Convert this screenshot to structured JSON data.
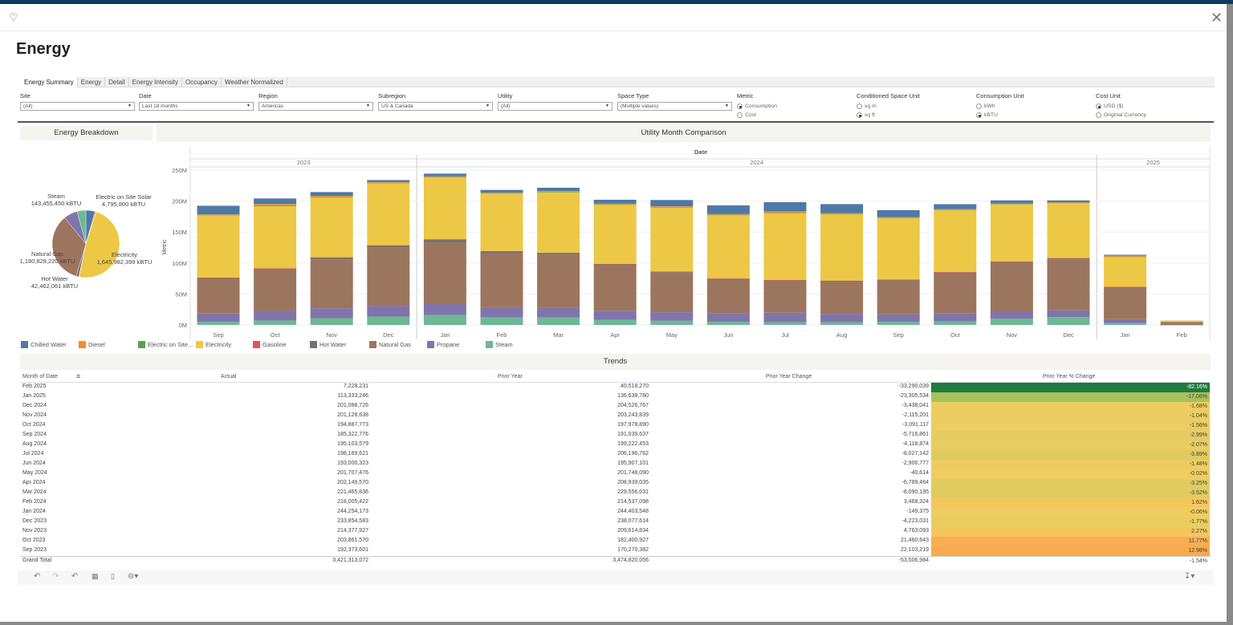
{
  "window": {
    "title": "Energy",
    "heart_icon": "heart-icon",
    "close_icon": "close-icon"
  },
  "tabs": [
    {
      "label": "Energy Summary",
      "active": true
    },
    {
      "label": "Energy"
    },
    {
      "label": "Detail"
    },
    {
      "label": "Energy Intensity"
    },
    {
      "label": "Occupancy"
    },
    {
      "label": "Weather Normalized"
    }
  ],
  "filters": [
    {
      "label": "Site",
      "type": "dropdown",
      "value": "(All)"
    },
    {
      "label": "Date",
      "type": "dropdown",
      "value": "Last 18 months"
    },
    {
      "label": "Region",
      "type": "dropdown",
      "value": "Americas"
    },
    {
      "label": "Subregion",
      "type": "dropdown",
      "value": "US & Canada"
    },
    {
      "label": "Utility",
      "type": "dropdown",
      "value": "(All)"
    },
    {
      "label": "Space Type",
      "type": "dropdown",
      "value": "(Multiple values)"
    },
    {
      "label": "Metric",
      "type": "radio",
      "options": [
        "Consumption",
        "Cost"
      ],
      "selected": 0
    },
    {
      "label": "Conditioned Space Unit",
      "type": "radio",
      "options": [
        "sq m",
        "sq ft"
      ],
      "selected": 1
    },
    {
      "label": "Consumption Unit",
      "type": "radio",
      "options": [
        "kWh",
        "kBTU"
      ],
      "selected": 1
    },
    {
      "label": "Cost Unit",
      "type": "radio",
      "options": [
        "USD ($)",
        "Original Currency"
      ],
      "selected": 0
    }
  ],
  "colors": {
    "Chilled Water": "#4e79a7",
    "Diesel": "#f28e2b",
    "Electric on Site Solar": "#59a14f",
    "Electricity": "#ecc846",
    "Gasoline": "#e15759",
    "Hot Water": "#76706e",
    "Natural Gas": "#9c755f",
    "Propane": "#8075ab",
    "Steam": "#6db895"
  },
  "energy_breakdown": {
    "title": "Energy Breakdown"
  },
  "utility_month": {
    "title": "Utility Month Comparison"
  },
  "legend": [
    "Chilled Water",
    "Diesel",
    "Electric on Site...",
    "Electricity",
    "Gasoline",
    "Hot Water",
    "Natural Gas",
    "Propane",
    "Steam"
  ],
  "chart_data": [
    {
      "type": "pie",
      "title": "Energy Breakdown",
      "unit": "kBTU",
      "slices": [
        {
          "name": "Chilled Water",
          "value": 150000000
        },
        {
          "name": "Diesel",
          "value": 20000000
        },
        {
          "name": "Electric on Site Solar",
          "value": 4795800,
          "label": "Electric on Site Solar",
          "value_text": "4,795,800 kBTU"
        },
        {
          "name": "Electricity",
          "value": 1645982399,
          "label": "Electricity",
          "value_text": "1,645,982,399 kBTU"
        },
        {
          "name": "Gasoline",
          "value": 8000000
        },
        {
          "name": "Hot Water",
          "value": 42462061,
          "label": "Hot Water",
          "value_text": "42,462,061 kBTU"
        },
        {
          "name": "Natural Gas",
          "value": 1180828220,
          "label": "Natural Gas",
          "value_text": "1,180,828,220 kBTU"
        },
        {
          "name": "Propane",
          "value": 227000000
        },
        {
          "name": "Steam",
          "value": 143455450,
          "label": "Steam",
          "value_text": "143,455,450 kBTU"
        }
      ]
    },
    {
      "type": "bar",
      "stacked": true,
      "title": "Utility Month Comparison",
      "xlabel": "Date",
      "ylabel": "Metric",
      "ylim": [
        0,
        250
      ],
      "yticks": [
        "0M",
        "50M",
        "100M",
        "150M",
        "200M",
        "250M"
      ],
      "grid": true,
      "legend": "bottom",
      "years": [
        {
          "label": "2023",
          "months": 4
        },
        {
          "label": "2024",
          "months": 12
        },
        {
          "label": "2025",
          "months": 2
        }
      ],
      "categories": [
        "Sep",
        "Oct",
        "Nov",
        "Dec",
        "Jan",
        "Feb",
        "Mar",
        "Apr",
        "May",
        "Jun",
        "Jul",
        "Aug",
        "Sep",
        "Oct",
        "Nov",
        "Dec",
        "Jan",
        "Feb"
      ],
      "series": [
        {
          "name": "Steam",
          "values": [
            5,
            7,
            11,
            13.5,
            16,
            12,
            12,
            8.4,
            6.7,
            5,
            4.2,
            4.2,
            5,
            5.9,
            10,
            12.6,
            3,
            0.2
          ]
        },
        {
          "name": "Propane",
          "values": [
            13.5,
            15.7,
            16,
            17.5,
            17.7,
            16.6,
            16,
            14.6,
            13.9,
            14,
            15.6,
            13.8,
            12,
            13.1,
            12,
            11,
            6.3,
            0.3
          ]
        },
        {
          "name": "Natural Gas",
          "values": [
            57.3,
            68.3,
            79,
            93.6,
            99.7,
            87.4,
            85,
            72,
            64.4,
            55,
            51.7,
            52.7,
            55.4,
            65.6,
            78,
            82.4,
            51.3,
            4
          ]
        },
        {
          "name": "Hot Water",
          "values": [
            0.5,
            0.3,
            3,
            3.8,
            4.6,
            3,
            3,
            3,
            1,
            0.5,
            0.5,
            0.5,
            0.5,
            0.5,
            2,
            1.7,
            0.5,
            0.1
          ]
        },
        {
          "name": "Gasoline",
          "values": [
            0.3,
            0.3,
            0.3,
            0.3,
            0.4,
            0.4,
            0.5,
            0.4,
            0.5,
            0.5,
            0.5,
            0.5,
            0.3,
            0.3,
            0.3,
            0.3,
            0.5,
            0
          ]
        },
        {
          "name": "Electricity",
          "values": [
            101,
            100.4,
            96.7,
            100.3,
            100.2,
            93.1,
            98.1,
            96,
            103.5,
            102.6,
            108,
            107.3,
            99.8,
            100.6,
            92.7,
            89,
            48.7,
            2.6
          ]
        },
        {
          "name": "Electric on Site Solar",
          "values": [
            0.3,
            0.3,
            0.5,
            0.5,
            0.5,
            0.5,
            0.5,
            0.5,
            0.5,
            0.4,
            0.4,
            0.5,
            0.5,
            0.4,
            0.5,
            0.5,
            0.3,
            0
          ]
        },
        {
          "name": "Diesel",
          "values": [
            0.5,
            3,
            2,
            1,
            1,
            0.8,
            1,
            1,
            1,
            1,
            2.5,
            1,
            0.5,
            0.5,
            0.6,
            0.6,
            1.5,
            0
          ]
        },
        {
          "name": "Chilled Water",
          "values": [
            14,
            8.9,
            6,
            3.4,
            4.2,
            4.2,
            5.4,
            6.2,
            10.2,
            14,
            14.8,
            14.6,
            11.3,
            8,
            5,
            3,
            1.2,
            0
          ]
        }
      ]
    }
  ],
  "trends": {
    "title": "Trends",
    "columns": [
      "Month of Date",
      "Actual",
      "Prior Year",
      "Prior Year Change",
      "Prior Year % Change"
    ],
    "sort_icon": "sort-icon",
    "rows": [
      {
        "month": "Feb 2025",
        "actual": "7,228,231",
        "prior": "40,518,270",
        "change": "-33,290,039",
        "pct": "-82.16%",
        "color": "#217a3e"
      },
      {
        "month": "Jan 2025",
        "actual": "113,333,246",
        "prior": "136,638,780",
        "change": "-23,305,534",
        "pct": "-17.06%",
        "color": "#a9c15b"
      },
      {
        "month": "Dec 2024",
        "actual": "201,088,726",
        "prior": "204,526,767",
        "change": "-3,438,041",
        "pct": "-1.68%",
        "color": "#eccd61"
      },
      {
        "month": "Nov 2024",
        "actual": "201,128,638",
        "prior": "203,243,839",
        "change": "-2,115,201",
        "pct": "-1.04%",
        "color": "#edcd61"
      },
      {
        "month": "Oct 2024",
        "actual": "194,887,773",
        "prior": "197,978,890",
        "change": "-3,091,117",
        "pct": "-1.56%",
        "color": "#eccd61"
      },
      {
        "month": "Sep 2024",
        "actual": "185,322,776",
        "prior": "191,039,637",
        "change": "-5,716,861",
        "pct": "-2.99%",
        "color": "#e4cc60"
      },
      {
        "month": "Aug 2024",
        "actual": "195,103,579",
        "prior": "199,222,453",
        "change": "-4,118,874",
        "pct": "-2.07%",
        "color": "#e9cd61"
      },
      {
        "month": "Jul 2024",
        "actual": "198,169,621",
        "prior": "206,196,762",
        "change": "-8,027,142",
        "pct": "-3.89%",
        "color": "#e0cb5f"
      },
      {
        "month": "Jun 2024",
        "actual": "193,000,323",
        "prior": "195,907,101",
        "change": "-2,906,777",
        "pct": "-1.48%",
        "color": "#eccd61"
      },
      {
        "month": "May 2024",
        "actual": "201,707,476",
        "prior": "201,748,090",
        "change": "-40,614",
        "pct": "-0.02%",
        "color": "#f1cd61"
      },
      {
        "month": "Apr 2024",
        "actual": "202,149,570",
        "prior": "208,939,035",
        "change": "-6,789,464",
        "pct": "-3.25%",
        "color": "#e2cc60"
      },
      {
        "month": "Mar 2024",
        "actual": "221,465,836",
        "prior": "229,556,031",
        "change": "-8,090,195",
        "pct": "-3.52%",
        "color": "#e1cb5f"
      },
      {
        "month": "Feb 2024",
        "actual": "218,005,422",
        "prior": "214,537,098",
        "change": "3,468,324",
        "pct": "1.62%",
        "color": "#f5c85e"
      },
      {
        "month": "Jan 2024",
        "actual": "244,254,173",
        "prior": "244,403,548",
        "change": "-149,375",
        "pct": "-0.06%",
        "color": "#f0cd61"
      },
      {
        "month": "Dec 2023",
        "actual": "233,854,583",
        "prior": "238,077,614",
        "change": "-4,223,031",
        "pct": "-1.77%",
        "color": "#eacd61"
      },
      {
        "month": "Nov 2023",
        "actual": "214,377,927",
        "prior": "209,614,834",
        "change": "4,763,093",
        "pct": "2.27%",
        "color": "#f4c75d"
      },
      {
        "month": "Oct 2023",
        "actual": "203,861,570",
        "prior": "182,400,927",
        "change": "21,460,643",
        "pct": "11.77%",
        "color": "#f8ae51"
      },
      {
        "month": "Sep 2023",
        "actual": "192,373,601",
        "prior": "170,270,382",
        "change": "22,103,219",
        "pct": "12.98%",
        "color": "#f8aa4f"
      }
    ],
    "total": {
      "month": "Grand Total",
      "actual": "3,421,313,072",
      "prior": "3,474,820,056",
      "change": "-53,506,984",
      "pct": "-1.54%"
    }
  },
  "toolbar": {
    "icons": [
      "undo-icon",
      "redo-icon",
      "revert-icon",
      "refresh-icon",
      "pause-icon",
      "share-icon",
      "download-icon"
    ]
  }
}
